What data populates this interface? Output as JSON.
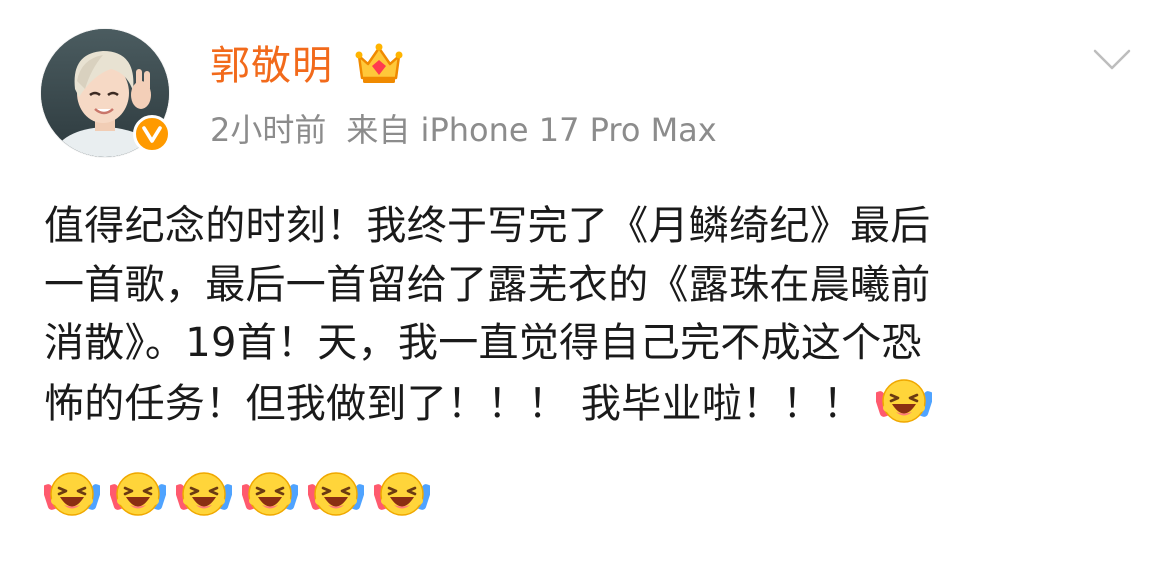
{
  "post": {
    "author": {
      "name": "郭敬明",
      "verified": true,
      "badge_icon": "crown-icon"
    },
    "meta": {
      "time": "2小时前",
      "source": "来自 iPhone 17 Pro Max"
    },
    "content_lines": [
      "值得纪念的时刻！我终于写完了《月鳞绮纪》最后",
      "一首歌，最后一首留给了露芜衣的《露珠在晨曦前",
      "消散》。19首！天，我一直觉得自己完不成这个恐",
      "怖的任务！但我做到了！！！ 我毕业啦！！！"
    ],
    "emoji_name": "laugh-cry-emoji",
    "emoji_count_inline": 1,
    "emoji_count_row": 6
  },
  "colors": {
    "username": "#f26a1b",
    "meta": "#8c8c8c",
    "text": "#1a1a1a",
    "verified": "#ff9a00"
  }
}
